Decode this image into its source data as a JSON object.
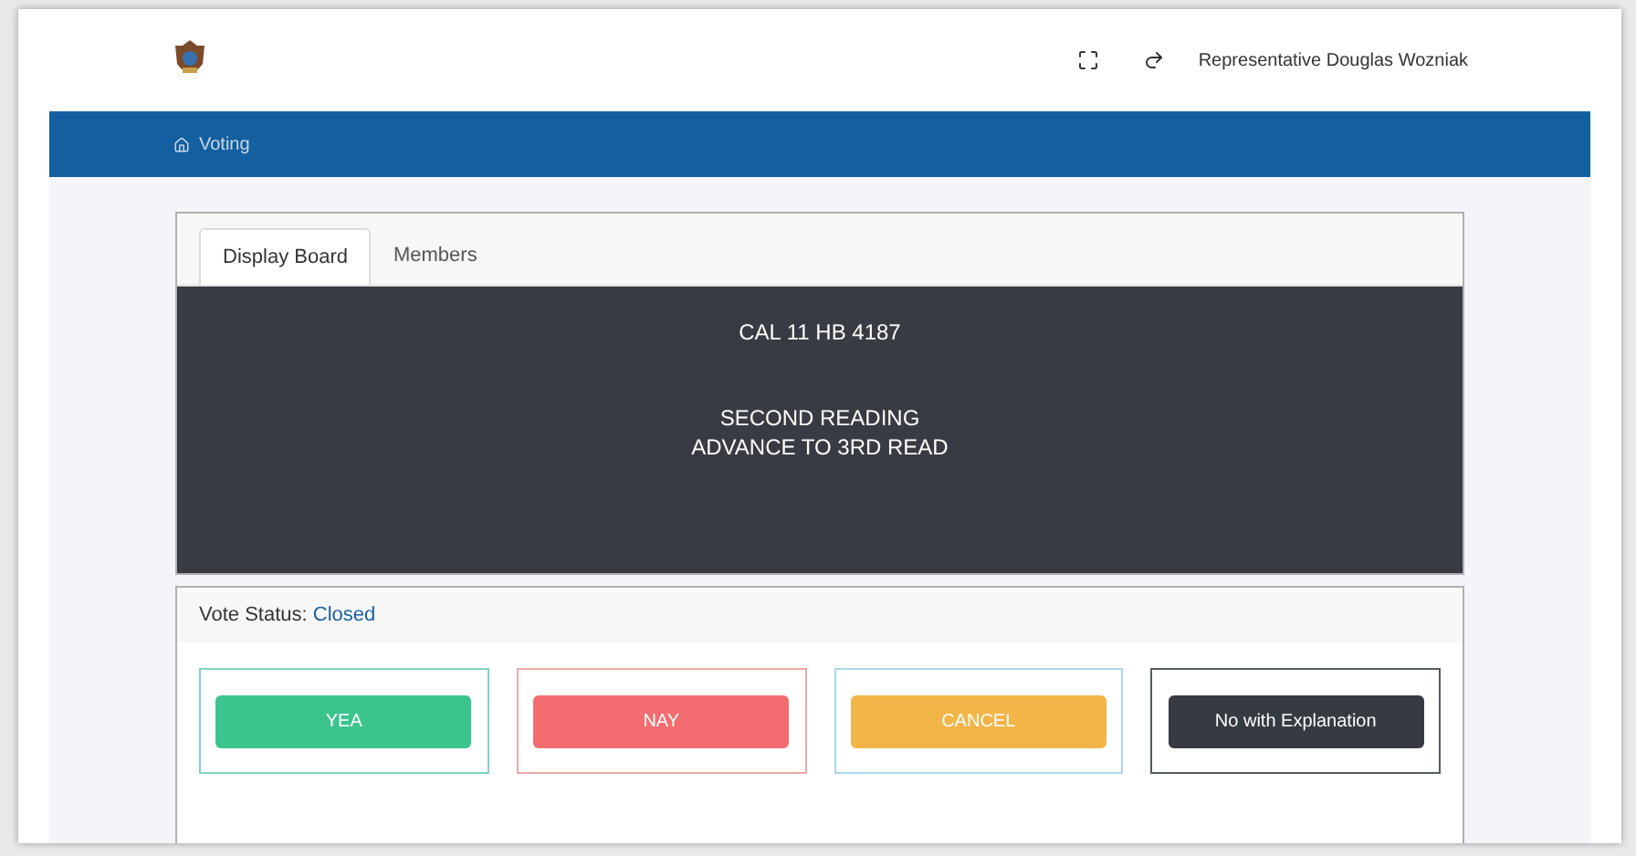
{
  "header": {
    "user": "Representative Douglas Wozniak"
  },
  "nav": {
    "label": "Voting"
  },
  "tabs": [
    {
      "label": "Display Board",
      "selected": true
    },
    {
      "label": "Members",
      "selected": false
    }
  ],
  "board": {
    "title": "CAL 11 HB 4187",
    "lines": [
      "SECOND READING",
      "ADVANCE TO 3RD READ"
    ]
  },
  "vote_status": {
    "label": "Vote Status:",
    "value": "Closed"
  },
  "vote_buttons": [
    {
      "label": "YEA",
      "kind": "yea"
    },
    {
      "label": "NAY",
      "kind": "nay"
    },
    {
      "label": "CANCEL",
      "kind": "cancel"
    },
    {
      "label": "No with Explanation",
      "kind": "explain"
    }
  ]
}
